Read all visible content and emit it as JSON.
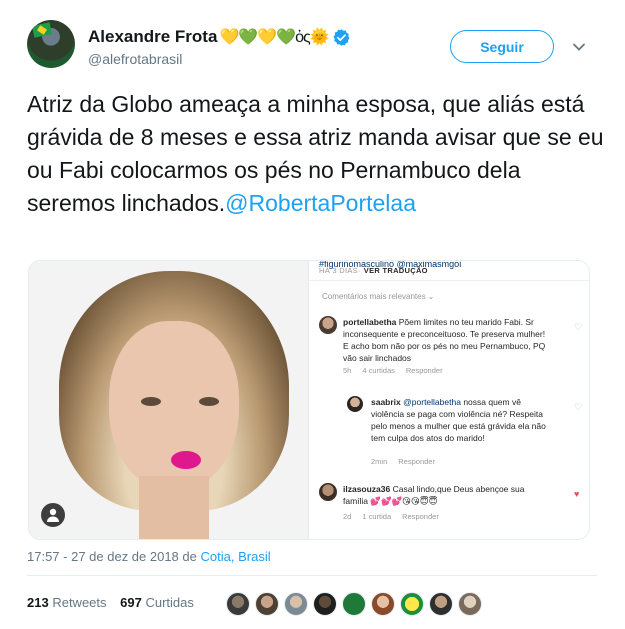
{
  "author": {
    "display_name": "Alexandre Frota",
    "emojis": "💛💚💛💚ὀς🌞",
    "handle": "@alefrotabrasil",
    "verified_icon": "verified-badge-icon"
  },
  "follow_button": {
    "label": "Seguir"
  },
  "tweet": {
    "text": "Atriz da Globo ameaça a minha esposa,  que aliás está grávida  de 8 meses e essa atriz manda avisar que se eu ou Fabi colocarmos os pés no  Pernambuco dela  seremos linchados.",
    "mention": "@RobertaPortelaa"
  },
  "instagram_screenshot": {
    "top_cut_text": "#figurinomasculino @maximasmgoi",
    "time_ago": "HÁ 3 DIAS",
    "translate": "VER TRADUÇÃO",
    "sort_label": "Comentários mais relevantes",
    "sort_arrow": "⌄",
    "comments": [
      {
        "user": "portellabetha",
        "text": "Põem limites no teu marido Fabi. Sr inconsequente e preconceituoso. Te preserva mulher! E acho bom não por os pés no meu Pernambuco, PQ vão sair linchados",
        "time": "5h",
        "likes": "4 curtidas",
        "reply": "Responder",
        "liked": false
      },
      {
        "user": "saabrix",
        "mention": "@portellabetha",
        "text": "nossa quem vê violência se paga com violência né? Respeita pelo menos a mulher que está grávida ela não tem culpa dos atos do marido!",
        "time": "2min",
        "reply": "Responder",
        "liked": false
      },
      {
        "user": "ilzasouza36",
        "text": "Casal lindo,que Deus abençoe sua família 💕💕💕😘😘😇😇",
        "time": "2d",
        "likes": "1 curtida",
        "reply": "Responder",
        "liked": true
      }
    ]
  },
  "meta": {
    "time": "17:57 - 27 de dez de 2018",
    "from_word": "de",
    "location": "Cotia, Brasil"
  },
  "stats": {
    "retweets_count": "213",
    "retweets_label": "Retweets",
    "likes_count": "697",
    "likes_label": "Curtidas"
  },
  "colors": {
    "link_blue": "#1da1f2",
    "secondary_text": "#657786",
    "heart_red": "#ed4956"
  }
}
